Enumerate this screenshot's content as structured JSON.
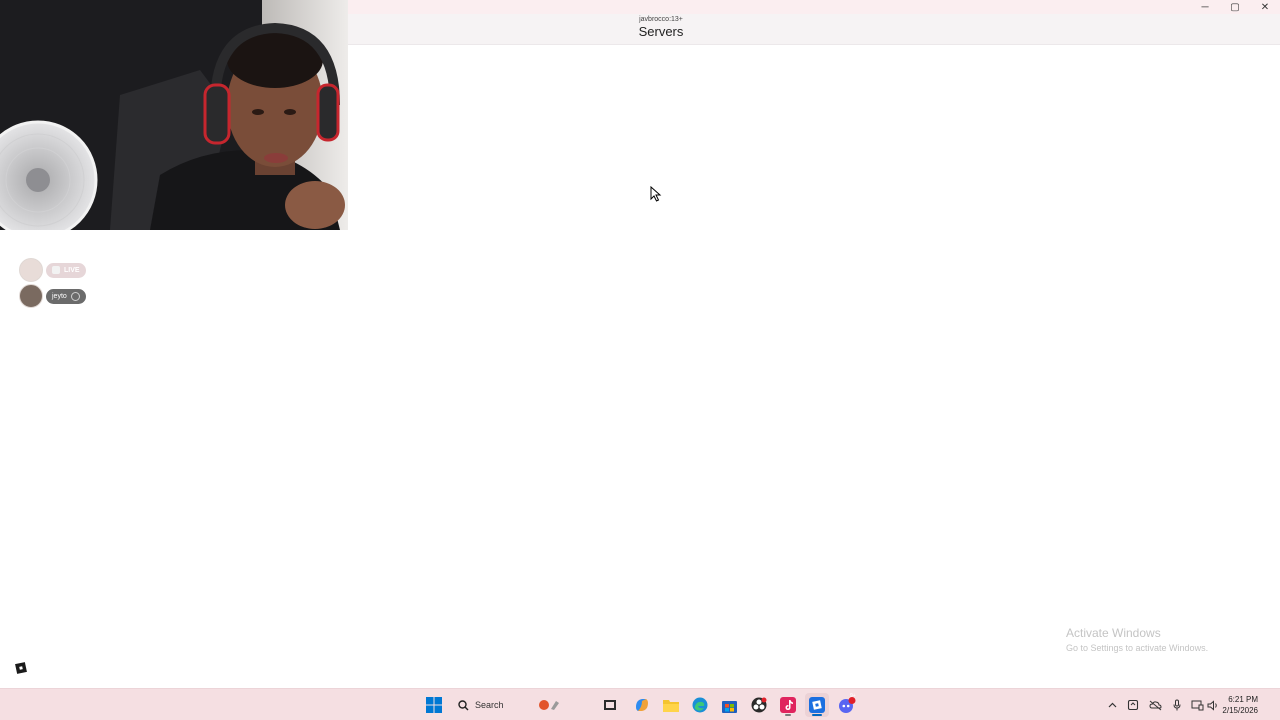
{
  "window": {
    "subtitle": "javbrocco:13+",
    "title": "Servers",
    "controls": {
      "minimize": "─",
      "maximize": "▢",
      "close": "✕"
    }
  },
  "webcam": {
    "label": "streamer-webcam"
  },
  "participants": [
    {
      "badge": "LIVE",
      "name": ""
    },
    {
      "badge": "",
      "name": "jeyto"
    }
  ],
  "watermark": {
    "line1": "Activate Windows",
    "line2": "Go to Settings to activate Windows."
  },
  "taskbar": {
    "search_label": "Search",
    "pinned": [
      "start-icon",
      "search",
      "task-view-icon",
      "copilot-icon",
      "file-explorer-icon",
      "edge-icon",
      "store-icon",
      "obs-icon",
      "tiktok-icon",
      "roblox-studio-icon",
      "discord-icon"
    ],
    "discord_badge": "9+",
    "clock_time": "6:21 PM",
    "clock_date": "2/15/2026"
  },
  "colors": {
    "taskbar": "#f5dfe2",
    "titlebar": "#f6f3f4",
    "accent_blue": "#0067c0"
  }
}
